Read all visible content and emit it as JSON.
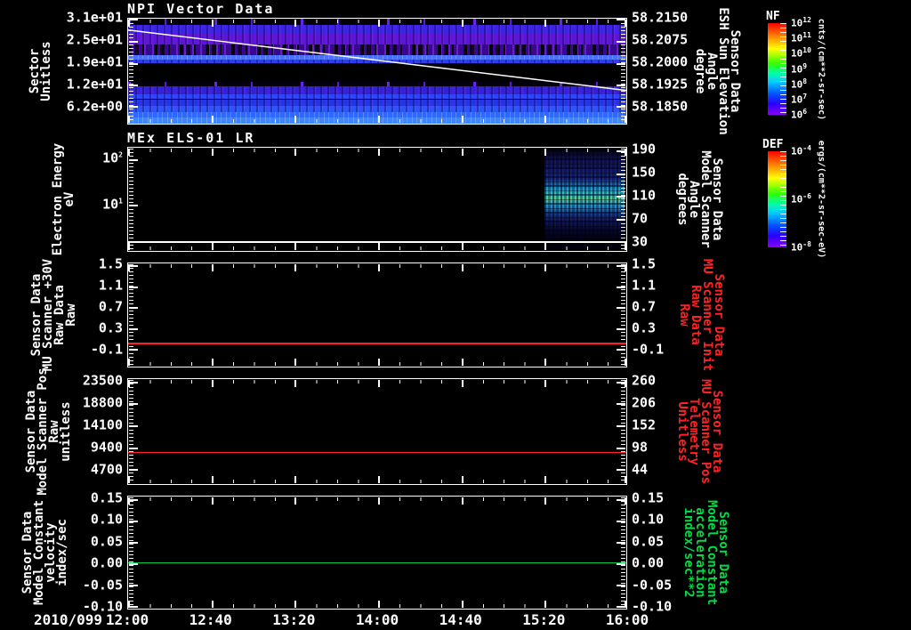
{
  "background_color": "#000000",
  "x_axis": {
    "date": "2010/099",
    "tick_labels": [
      "12:00",
      "12:40",
      "13:20",
      "14:00",
      "14:40",
      "15:20",
      "16:00"
    ]
  },
  "colorbars": [
    {
      "id": "nf",
      "label": "NF",
      "units": "cnts/(cm**2-sr-sec)",
      "ticks": [
        {
          "b": "10",
          "e": "12"
        },
        {
          "b": "10",
          "e": "11"
        },
        {
          "b": "10",
          "e": "10"
        },
        {
          "b": "10",
          "e": "9"
        },
        {
          "b": "10",
          "e": "8"
        },
        {
          "b": "10",
          "e": "7"
        },
        {
          "b": "10",
          "e": "6"
        }
      ],
      "tick_fracs": [
        0,
        0.1667,
        0.3333,
        0.5,
        0.6667,
        0.8333,
        1
      ]
    },
    {
      "id": "def",
      "label": "DEF",
      "units": "ergs/(cm**2-sr-sec-eV)",
      "ticks": [
        {
          "b": "10",
          "e": "-4"
        },
        {
          "b": "10",
          "e": "-6"
        },
        {
          "b": "10",
          "e": "-8"
        }
      ],
      "tick_fracs": [
        0,
        0.5,
        1
      ]
    }
  ],
  "panels": [
    {
      "id": "npi-vector-data",
      "title": "NPI Vector Data",
      "left_axis": {
        "label_lines": [
          "Sector",
          "Unitless"
        ],
        "label_color": "#ffffff",
        "ticks": [
          "3.1e+01",
          "2.5e+01",
          "1.9e+01",
          "1.2e+01",
          "6.2e+00"
        ],
        "tick_fracs": [
          0.0,
          0.21,
          0.42,
          0.625,
          0.83
        ]
      },
      "right_axis": {
        "label_lines": [
          "Sensor Data",
          "ESH Sun Elevation",
          "Angle",
          "degree"
        ],
        "label_color": "#ffffff",
        "ticks": [
          "58.2150",
          "58.2075",
          "58.2000",
          "58.1925",
          "58.1850"
        ],
        "tick_fracs": [
          0.0,
          0.21,
          0.42,
          0.625,
          0.83
        ]
      },
      "bands": [
        {
          "t": 0,
          "h": 5.8,
          "c": "#020005",
          "nz": "nz-blip"
        },
        {
          "t": 5.8,
          "h": 8.4,
          "c": "#3b23e8",
          "nz": "nz-soft"
        },
        {
          "t": 14.2,
          "h": 10.0,
          "c": "#5c14d8",
          "nz": "nz-soft"
        },
        {
          "t": 24.2,
          "h": 10.8,
          "c": "#3a0890",
          "nz": "nz-messy"
        },
        {
          "t": 35.0,
          "h": 4.2,
          "c": "#4a70ff",
          "nz": "nz-specks"
        },
        {
          "t": 39.2,
          "h": 3.3,
          "c": "#2c3cf0",
          "nz": "nz-soft"
        },
        {
          "t": 42.5,
          "h": 17.5,
          "c": "#000000",
          "nz": ""
        },
        {
          "t": 60.0,
          "h": 4.2,
          "c": "#05000f",
          "nz": "nz-blip"
        },
        {
          "t": 64.2,
          "h": 7.5,
          "c": "#3520d8",
          "nz": "nz-soft"
        },
        {
          "t": 71.7,
          "h": 5.0,
          "c": "#2c46ff",
          "nz": "nz-soft"
        },
        {
          "t": 76.7,
          "h": 6.6,
          "c": "#2333e8",
          "nz": "nz-soft"
        },
        {
          "t": 83.3,
          "h": 5.9,
          "c": "#2c55ff",
          "nz": "nz-soft"
        },
        {
          "t": 89.2,
          "h": 5.0,
          "c": "#2f68ff",
          "nz": "nz-specks"
        },
        {
          "t": 94.2,
          "h": 5.8,
          "c": "#3f86ff",
          "nz": "nz-specks"
        }
      ],
      "lines": [
        {
          "type": "diag",
          "y1_frac": 0.108,
          "y2_frac": 0.683,
          "color": "#ffffff",
          "w": 1.5
        }
      ]
    },
    {
      "id": "mex-els-01-lr",
      "title": "MEx ELS-01 LR",
      "left_axis": {
        "label_lines": [
          "Electron Energy",
          "eV"
        ],
        "label_color": "#ffffff",
        "ticks": [
          {
            "b": "10",
            "e": "2"
          },
          {
            "b": "10",
            "e": "1"
          }
        ],
        "tick_fracs": [
          0.11,
          0.55
        ]
      },
      "right_axis": {
        "label_lines": [
          "Sensor Data",
          "Model Scanner",
          "Angle",
          "degrees"
        ],
        "label_color": "#ffffff",
        "ticks": [
          "190",
          "150",
          "110",
          "70",
          "30"
        ],
        "tick_fracs": [
          0.025,
          0.246,
          0.466,
          0.686,
          0.907
        ]
      },
      "bands": [],
      "burst": {
        "x_frac": 0.835,
        "w_frac": 0.162
      },
      "lines": [
        {
          "type": "h",
          "frac": 0.915,
          "color": "#ffffff",
          "w": 1.5
        }
      ]
    },
    {
      "id": "mu-scanner-plus30v",
      "title": "",
      "left_axis": {
        "label_lines": [
          "Sensor Data",
          "MU Scanner +30V",
          "Raw Data",
          "Raw"
        ],
        "label_color": "#ffffff",
        "ticks": [
          "1.5",
          "1.1",
          "0.7",
          "0.3",
          "-0.1"
        ],
        "tick_fracs": [
          0.017,
          0.22,
          0.424,
          0.627,
          0.831
        ]
      },
      "right_axis": {
        "label_lines": [
          "Sensor Data",
          "MU Scanner Init",
          "Raw Data",
          "Raw"
        ],
        "label_color": "#ff2222",
        "ticks": [
          "1.5",
          "1.1",
          "0.7",
          "0.3",
          "-0.1"
        ],
        "tick_fracs": [
          0.017,
          0.22,
          0.424,
          0.627,
          0.831
        ]
      },
      "bands": [],
      "lines": [
        {
          "type": "h",
          "frac": 0.78,
          "color": "#ff2222",
          "w": 1.5
        }
      ]
    },
    {
      "id": "model-scanner-pos",
      "title": "",
      "left_axis": {
        "label_lines": [
          "Sensor Data",
          "Model Scanner Pos",
          "Raw",
          "unitless"
        ],
        "label_color": "#ffffff",
        "ticks": [
          "23500",
          "18800",
          "14100",
          "9400",
          "4700"
        ],
        "tick_fracs": [
          0.025,
          0.233,
          0.442,
          0.65,
          0.858
        ]
      },
      "right_axis": {
        "label_lines": [
          "Sensor Data",
          "MU Scanner Pos",
          "Telemetry",
          "Unitless"
        ],
        "label_color": "#ff2222",
        "ticks": [
          "260",
          "206",
          "152",
          "98",
          "44"
        ],
        "tick_fracs": [
          0.025,
          0.233,
          0.442,
          0.65,
          0.858
        ]
      },
      "bands": [],
      "lines": [
        {
          "type": "h",
          "frac": 0.7,
          "color": "#ff2222",
          "w": 1.5
        }
      ]
    },
    {
      "id": "model-constant-velocity",
      "title": "",
      "left_axis": {
        "label_lines": [
          "Sensor Data",
          "Model Constant",
          "velocity",
          "index/sec"
        ],
        "label_color": "#ffffff",
        "ticks": [
          "0.15",
          "0.10",
          "0.05",
          "0.00",
          "-0.05",
          "-0.10"
        ],
        "tick_fracs": [
          0.023,
          0.211,
          0.406,
          0.594,
          0.789,
          0.977
        ]
      },
      "right_axis": {
        "label_lines": [
          "Sensor Data",
          "Model Constant",
          "acceleration",
          "index/sec**2"
        ],
        "label_color": "#00dd44",
        "ticks": [
          "0.15",
          "0.10",
          "0.05",
          "0.00",
          "-0.05",
          "-0.10"
        ],
        "tick_fracs": [
          0.023,
          0.211,
          0.406,
          0.594,
          0.789,
          0.977
        ]
      },
      "bands": [],
      "lines": [
        {
          "type": "h",
          "frac": 0.594,
          "color": "#00cc44",
          "w": 1.5
        }
      ]
    }
  ],
  "chart_data": [
    {
      "type": "heatmap",
      "title": "NPI Vector Data",
      "x_date": "2010/099",
      "x_range": [
        "12:00",
        "16:00"
      ],
      "x_ticks": [
        "12:00",
        "12:40",
        "13:20",
        "14:00",
        "14:40",
        "15:20",
        "16:00"
      ],
      "ylabel": "Sector Unitless",
      "yticks": [
        31,
        25,
        19,
        12,
        6.2
      ],
      "y2label": "Sensor Data ESH Sun Elevation Angle degree",
      "y2ticks": [
        58.215,
        58.2075,
        58.2,
        58.1925,
        58.185
      ],
      "colorbar": {
        "name": "NF",
        "units": "cnts/(cm**2-sr-sec)",
        "range": [
          "1e6",
          "1e12"
        ]
      },
      "content_summary": "Horizontal banded count-rate spectrogram over 32 sectors: violet/purple bands at high sectors with a noisy black-speckled band near sector 22-25, bright blue stripe near sector 19, black gap near sectors 12-16, and increasingly bright blue bands toward sector 0",
      "overlay_line": {
        "name": "ESH Sun Elevation Angle",
        "start_y2": 58.211,
        "end_y2": 58.189,
        "trend": "linear decrease 12:00 to 16:00"
      }
    },
    {
      "type": "heatmap",
      "title": "MEx ELS-01 LR",
      "x_range": [
        "12:00",
        "16:00"
      ],
      "ylabel": "Electron Energy eV",
      "yscale": "log",
      "yticks": [
        100,
        10
      ],
      "y2label": "Sensor Data Model Scanner Angle degrees",
      "y2ticks": [
        190,
        150,
        110,
        70,
        30
      ],
      "colorbar": {
        "name": "DEF",
        "units": "ergs/(cm**2-sr-sec-eV)",
        "range": [
          "1e-8",
          "1e-4"
        ]
      },
      "content_summary": "Black (no data) until ~15:20, then speckled blue electron flux burst until 16:00 with brightest cyan/green core roughly mid-panel",
      "overlay_line": {
        "name": "constant line near bottom",
        "y2_value": 28
      }
    },
    {
      "type": "line",
      "ylabel": "Sensor Data MU Scanner +30V Raw Data Raw",
      "y2label": "Sensor Data MU Scanner Init Raw Data Raw",
      "yticks": [
        1.5,
        1.1,
        0.7,
        0.3,
        -0.1
      ],
      "ylim": [
        -0.3,
        1.5
      ],
      "series": [
        {
          "name": "MU Scanner +30V / Init",
          "color": "#ff0000",
          "constant_value": 0.0
        }
      ]
    },
    {
      "type": "line",
      "ylabel": "Sensor Data Model Scanner Pos Raw unitless",
      "y2label": "Sensor Data MU Scanner Pos Telemetry Unitless",
      "yticks": [
        23500,
        18800,
        14100,
        9400,
        4700
      ],
      "y2ticks": [
        260,
        206,
        152,
        98,
        44
      ],
      "series": [
        {
          "name": "Model Scanner Pos",
          "color": "#ff0000",
          "constant_value": 8300
        }
      ]
    },
    {
      "type": "line",
      "ylabel": "Sensor Data Model Constant velocity index/sec",
      "y2label": "Sensor Data Model Constant acceleration index/sec**2",
      "yticks": [
        0.15,
        0.1,
        0.05,
        0.0,
        -0.05,
        -0.1
      ],
      "ylim": [
        -0.1,
        0.15
      ],
      "series": [
        {
          "name": "Model Constant velocity/acceleration",
          "color": "#00cc44",
          "constant_value": 0.0
        }
      ]
    }
  ]
}
